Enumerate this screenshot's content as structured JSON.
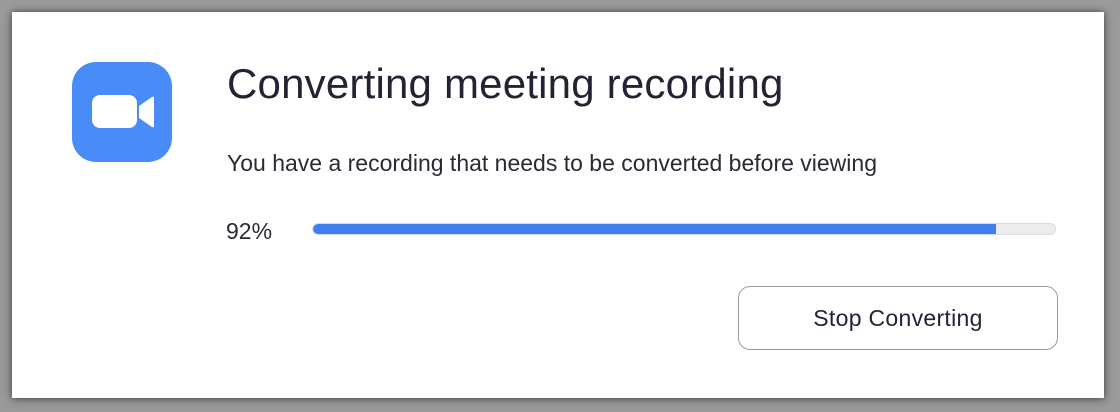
{
  "dialog": {
    "title": "Converting meeting recording",
    "message": "You have a recording that needs to be converted before viewing",
    "progress": {
      "percent_label": "92%",
      "fraction": 0.92
    },
    "stop_button_label": "Stop Converting"
  },
  "icon": {
    "name": "video-camera-icon",
    "background_color": "#4A8CF7",
    "glyph_color": "#FFFFFF"
  },
  "colors": {
    "progress_fill": "#3D7EF0",
    "progress_track": "#ECECEF"
  }
}
